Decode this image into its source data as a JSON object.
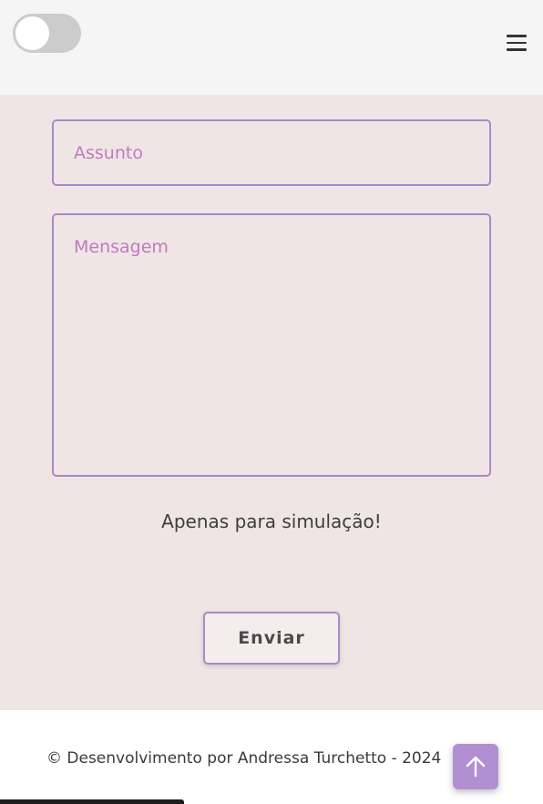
{
  "header": {
    "theme_toggle": {
      "state": "off"
    },
    "menu_icon": "hamburger-menu-icon"
  },
  "form": {
    "subject": {
      "placeholder": "Assunto",
      "value": ""
    },
    "message": {
      "placeholder": "Mensagem",
      "value": ""
    },
    "note": "Apenas para simulação!",
    "submit_label": "Enviar"
  },
  "footer": {
    "copyright": "© Desenvolvimento por Andressa Turchetto - 2024",
    "scroll_top_icon": "arrow-up-icon"
  },
  "colors": {
    "header_bg": "#f5f5f5",
    "form_bg": "#efe5e5",
    "accent_border": "#a98ac7",
    "placeholder": "#c07bbd",
    "scroll_button": "#b28fd1",
    "text": "#3e3e3e"
  }
}
